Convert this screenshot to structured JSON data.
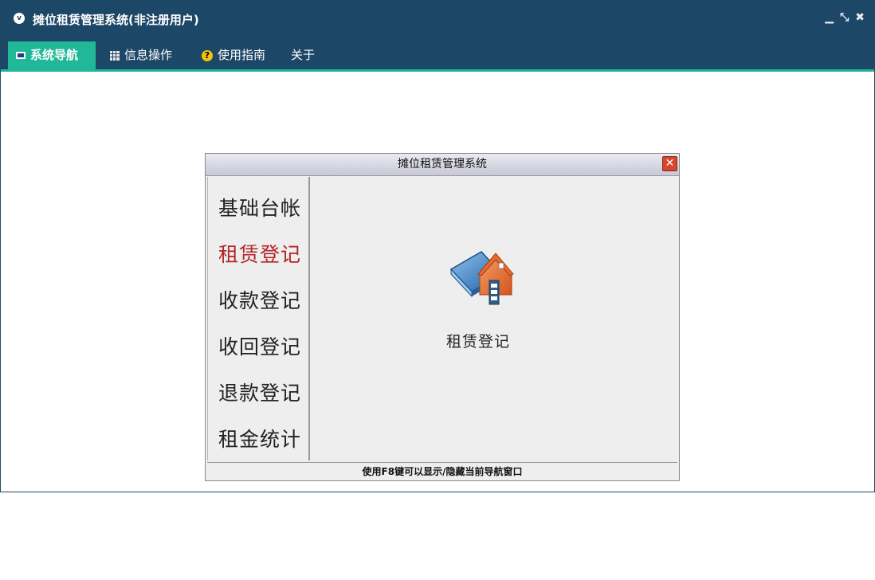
{
  "window": {
    "title": "摊位租赁管理系统(非注册用户)",
    "logo_glyph": "v",
    "controls": {
      "minimize": "▁",
      "restore": "⤡",
      "close": "✖"
    }
  },
  "menu": {
    "items": [
      {
        "label": "系统导航",
        "icon": "monitor-icon",
        "active": true
      },
      {
        "label": "信息操作",
        "icon": "grid-icon",
        "active": false
      },
      {
        "label": "使用指南",
        "icon": "help-icon",
        "active": false
      },
      {
        "label": "关于",
        "icon": "",
        "active": false
      }
    ],
    "help_glyph": "?"
  },
  "dialog": {
    "title": "摊位租赁管理系统",
    "close_glyph": "✕",
    "nav_items": [
      "基础台帐",
      "租赁登记",
      "收款登记",
      "收回登记",
      "退款登记",
      "租金统计"
    ],
    "selected_index": 1,
    "feature": {
      "label": "租赁登记",
      "icon": "book-house-icon"
    },
    "status_text": "使用F8键可以显示/隐藏当前导航窗口"
  },
  "colors": {
    "title_bar": "#1d4766",
    "menu_active": "#21b898",
    "accent_line": "#1fb59c",
    "selected_nav_text": "#b32424",
    "dialog_bg": "#eeeeee"
  }
}
